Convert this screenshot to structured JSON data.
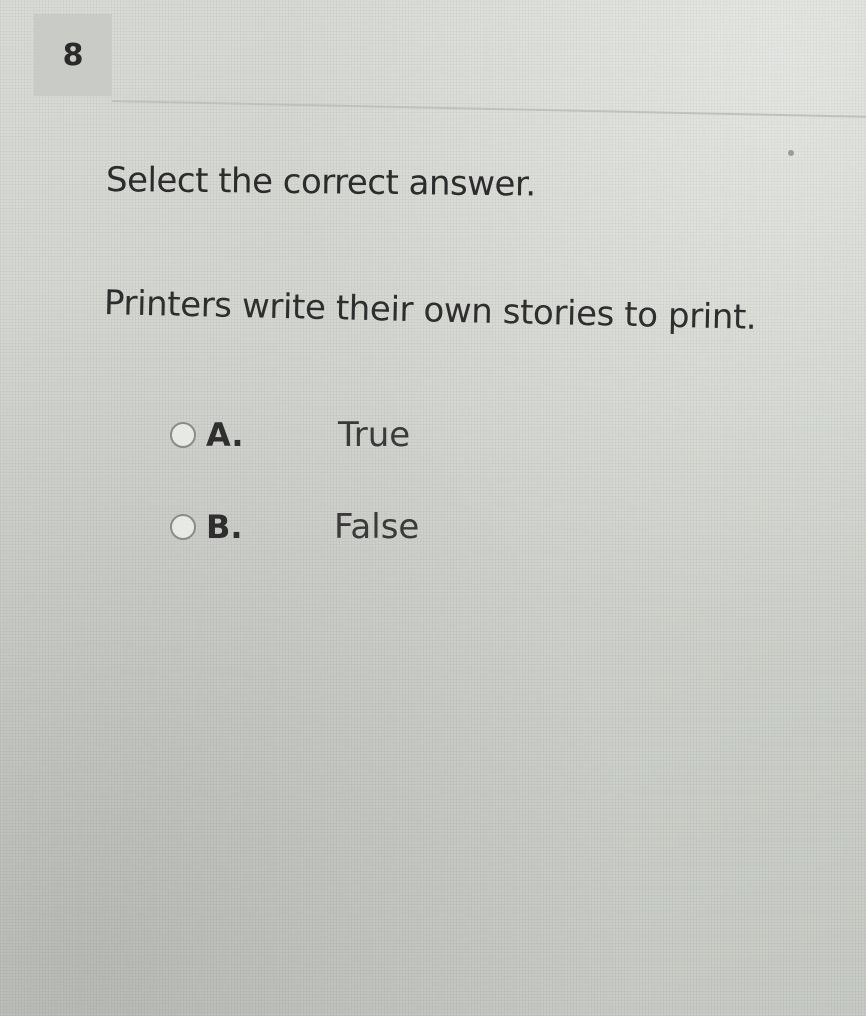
{
  "question": {
    "number": "8",
    "instruction": "Select the correct answer.",
    "prompt": "Printers write their own stories to print.",
    "options": [
      {
        "letter": "A.",
        "text": "True"
      },
      {
        "letter": "B.",
        "text": "False"
      }
    ]
  }
}
